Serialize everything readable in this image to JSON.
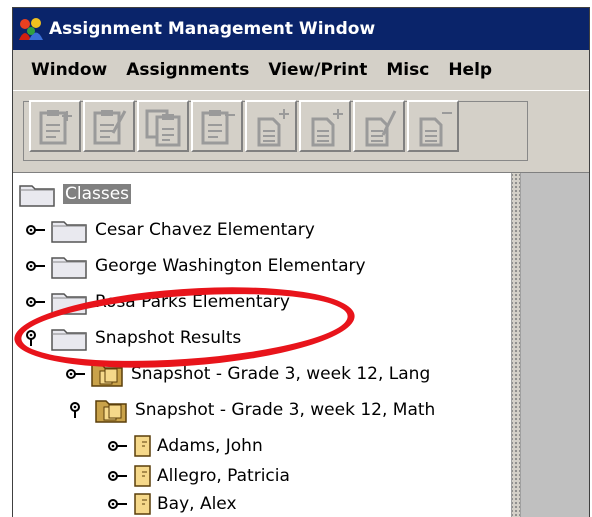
{
  "window": {
    "title": "Assignment Management Window",
    "app_icon": "user-group-icon"
  },
  "menubar": {
    "items": [
      {
        "label": "Window"
      },
      {
        "label": "Assignments"
      },
      {
        "label": "View/Print"
      },
      {
        "label": "Misc"
      },
      {
        "label": "Help"
      }
    ]
  },
  "toolbar": {
    "buttons": [
      {
        "icon": "add-clipboard-icon",
        "enabled": false
      },
      {
        "icon": "edit-clipboard-icon",
        "enabled": false
      },
      {
        "icon": "copy-clipboard-icon",
        "enabled": false
      },
      {
        "icon": "remove-clipboard-icon",
        "enabled": false
      },
      {
        "icon": "add-document-icon",
        "enabled": false
      },
      {
        "icon": "add-document-icon",
        "enabled": false
      },
      {
        "icon": "edit-document-icon",
        "enabled": false
      },
      {
        "icon": "remove-document-icon",
        "enabled": false
      }
    ]
  },
  "tree": {
    "root": {
      "label": "Classes",
      "selected": true
    },
    "nodes": [
      {
        "label": "Cesar Chavez Elementary",
        "expanded": false
      },
      {
        "label": "George Washington Elementary",
        "expanded": false
      },
      {
        "label": "Rosa Parks Elementary",
        "expanded": false
      },
      {
        "label": "Snapshot Results",
        "expanded": true
      },
      {
        "label": "Snapshot - Grade 3, week 12, Lang",
        "expanded": false
      },
      {
        "label": "Snapshot - Grade 3, week 12, Math",
        "expanded": true
      },
      {
        "label": "Adams, John",
        "expanded": false
      },
      {
        "label": "Allegro, Patricia",
        "expanded": false
      },
      {
        "label": "Bay, Alex",
        "expanded": false
      }
    ]
  },
  "colors": {
    "titlebar": "#0a246a",
    "annotation": "#e8141b",
    "folder_tab": "#c9a24a"
  }
}
